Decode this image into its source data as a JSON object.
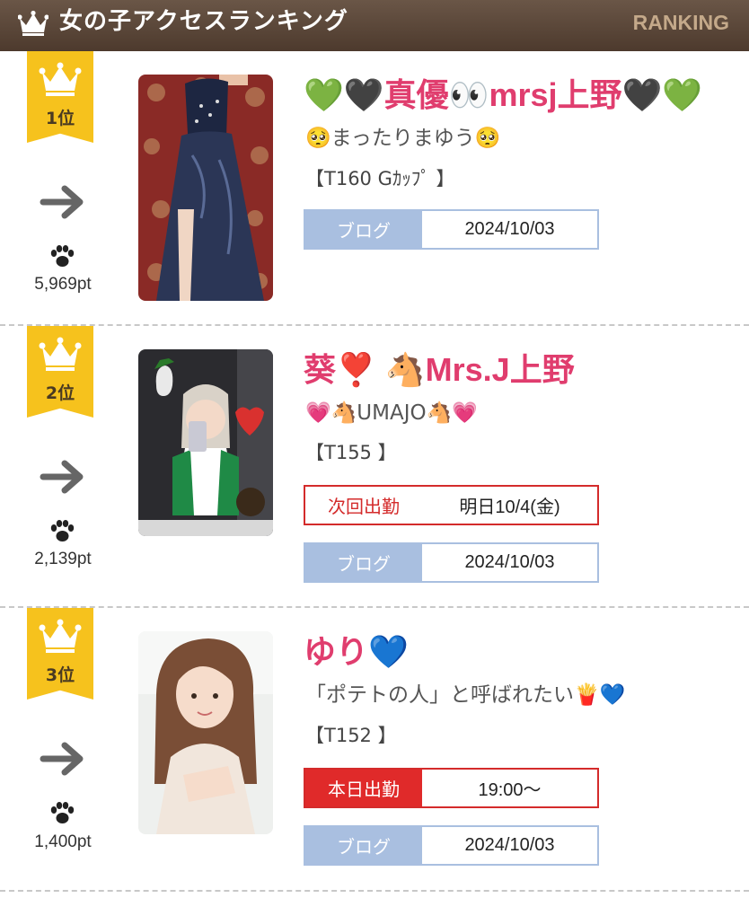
{
  "header": {
    "title": "女の子アクセスランキング",
    "subtitle": "RANKING"
  },
  "colors": {
    "accent": "#e03d6e",
    "gold": "#f6c21d",
    "blog": "#a9bfe0",
    "work": "#d42b2b"
  },
  "entries": [
    {
      "rank": "1位",
      "trend_icon": "arrow-right-icon",
      "points": "5,969pt",
      "name": "💚🖤真優👀mrsj上野🖤💚",
      "catch": "🥺まったりまゆう🥺",
      "size": "【T160 Gｶｯﾌﾟ 】",
      "blog_label": "ブログ",
      "blog_date": "2024/10/03"
    },
    {
      "rank": "2位",
      "trend_icon": "arrow-right-icon",
      "points": "2,139pt",
      "name": "葵❣️ 🐴Mrs.J上野",
      "catch": "💗🐴UMAJO🐴💗",
      "size": "【T155 】",
      "work_label": "次回出勤",
      "work_value": "明日10/4(金)",
      "blog_label": "ブログ",
      "blog_date": "2024/10/03"
    },
    {
      "rank": "3位",
      "trend_icon": "arrow-right-icon",
      "points": "1,400pt",
      "name": "ゆり💙",
      "catch": "「ポテトの人」と呼ばれたい🍟💙",
      "size": "【T152 】",
      "work_label": "本日出勤",
      "work_value": "19:00〜",
      "blog_label": "ブログ",
      "blog_date": "2024/10/03"
    }
  ]
}
